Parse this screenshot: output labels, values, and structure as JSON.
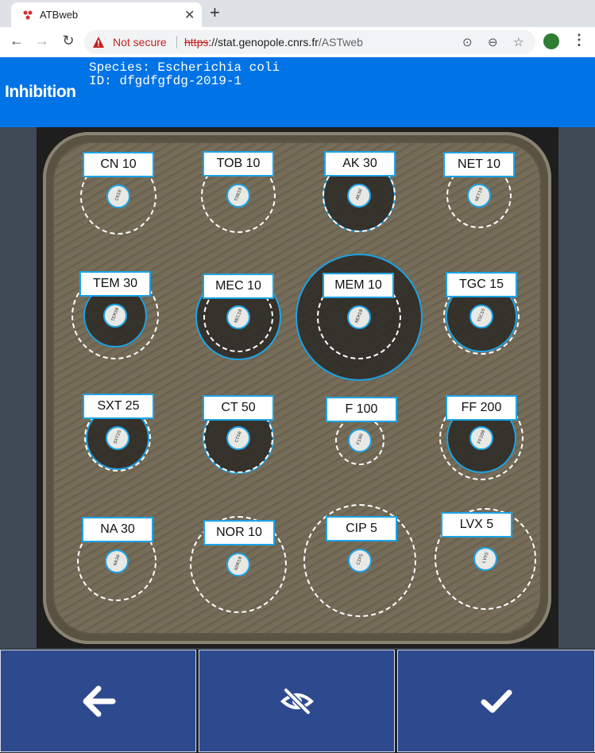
{
  "browser": {
    "tab_title": "ATBweb",
    "security_label": "Not secure",
    "url_scheme": "https",
    "url_host": "://stat.genopole.cnrs.fr",
    "url_path": "/ASTweb"
  },
  "header": {
    "title": "Inhibition",
    "species_line": "Species: Escherichia coli",
    "id_line": "ID: dfgdfgfdg-2019-1"
  },
  "antibiotics": [
    {
      "label": "CN 10",
      "code": "CN10"
    },
    {
      "label": "TOB 10",
      "code": "TOB10"
    },
    {
      "label": "AK 30",
      "code": "AK30"
    },
    {
      "label": "NET 10",
      "code": "NET10"
    },
    {
      "label": "TEM 30",
      "code": "TEM30"
    },
    {
      "label": "MEC 10",
      "code": "MEC10"
    },
    {
      "label": "MEM 10",
      "code": "MEM10"
    },
    {
      "label": "TGC 15",
      "code": "TGC15"
    },
    {
      "label": "SXT 25",
      "code": "SXT25"
    },
    {
      "label": "CT 50",
      "code": "CT50"
    },
    {
      "label": "F 100",
      "code": "F100"
    },
    {
      "label": "FF 200",
      "code": "FF200"
    },
    {
      "label": "NA 30",
      "code": "NA30"
    },
    {
      "label": "NOR 10",
      "code": "NOR10"
    },
    {
      "label": "CIP 5",
      "code": "CIP5"
    },
    {
      "label": "LVX 5",
      "code": "LVX5"
    }
  ],
  "icons": {
    "back": "arrow-left-icon",
    "visibility": "eye-off-icon",
    "confirm": "checkmark-icon"
  },
  "colors": {
    "header_bg": "#0073e6",
    "ring": "#1ea4e6",
    "button_bg": "#2e4a8e"
  }
}
